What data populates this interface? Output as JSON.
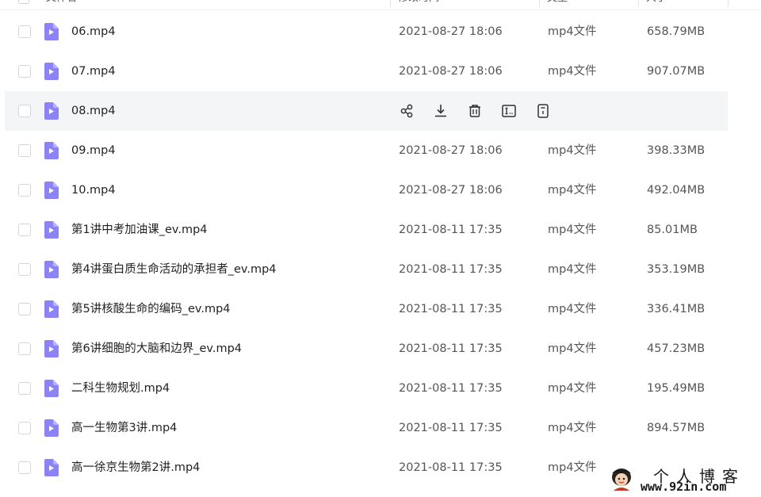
{
  "header": {
    "name_label": "文件名",
    "date_label": "修改时间",
    "type_label": "类型",
    "size_label": "大小"
  },
  "files": [
    {
      "name": "06.mp4",
      "date": "2021-08-27 18:06",
      "type": "mp4文件",
      "size": "658.79MB"
    },
    {
      "name": "07.mp4",
      "date": "2021-08-27 18:06",
      "type": "mp4文件",
      "size": "907.07MB"
    },
    {
      "name": "08.mp4",
      "date": "",
      "type": "",
      "size": "",
      "hovered": true
    },
    {
      "name": "09.mp4",
      "date": "2021-08-27 18:06",
      "type": "mp4文件",
      "size": "398.33MB"
    },
    {
      "name": "10.mp4",
      "date": "2021-08-27 18:06",
      "type": "mp4文件",
      "size": "492.04MB"
    },
    {
      "name": "第1讲中考加油课_ev.mp4",
      "date": "2021-08-11 17:35",
      "type": "mp4文件",
      "size": "85.01MB"
    },
    {
      "name": "第4讲蛋白质生命活动的承担者_ev.mp4",
      "date": "2021-08-11 17:35",
      "type": "mp4文件",
      "size": "353.19MB"
    },
    {
      "name": "第5讲核酸生命的编码_ev.mp4",
      "date": "2021-08-11 17:35",
      "type": "mp4文件",
      "size": "336.41MB"
    },
    {
      "name": "第6讲细胞的大脑和边界_ev.mp4",
      "date": "2021-08-11 17:35",
      "type": "mp4文件",
      "size": "457.23MB"
    },
    {
      "name": "二科生物规划.mp4",
      "date": "2021-08-11 17:35",
      "type": "mp4文件",
      "size": "195.49MB"
    },
    {
      "name": "高一生物第3讲.mp4",
      "date": "2021-08-11 17:35",
      "type": "mp4文件",
      "size": "894.57MB"
    },
    {
      "name": "高一徐京生物第2讲.mp4",
      "date": "2021-08-11 17:35",
      "type": "mp4文件",
      "size": ""
    }
  ],
  "hover_actions": [
    "share-icon",
    "download-icon",
    "delete-icon",
    "rename-icon",
    "details-icon"
  ],
  "colors": {
    "file_icon": "#8b83f6",
    "hover_row": "#f4f5f7"
  },
  "watermark": {
    "title": "个人博客",
    "url": "www.92in.com"
  }
}
